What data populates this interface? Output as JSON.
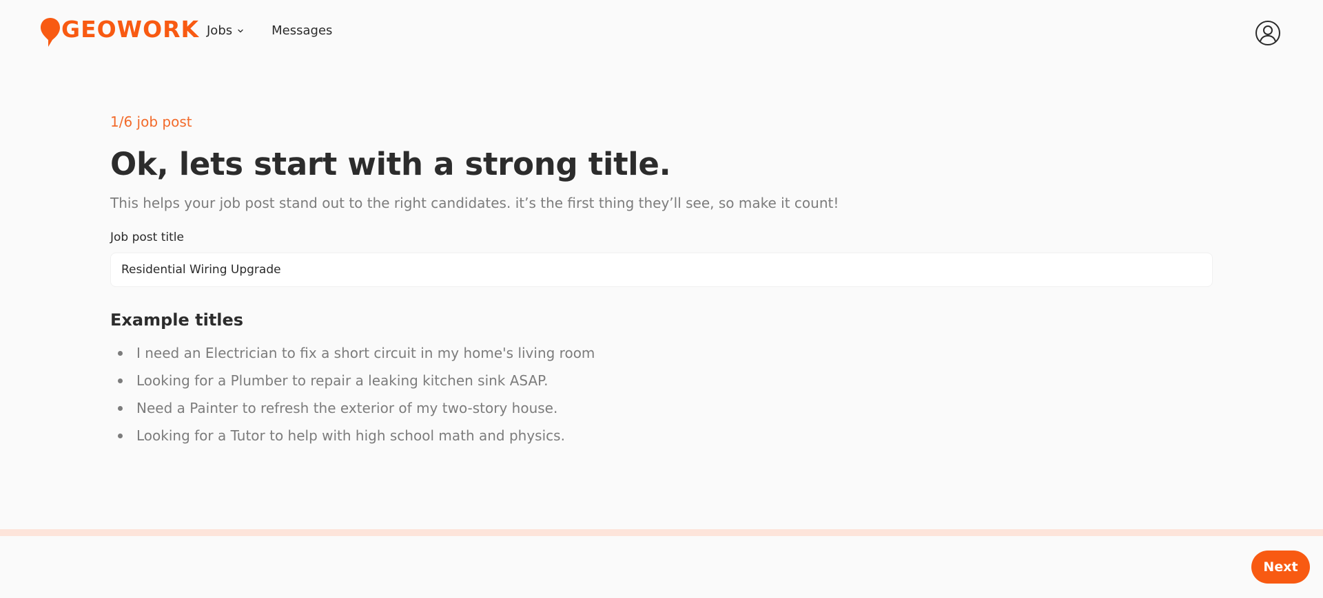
{
  "brand": {
    "name": "GEOWORK",
    "accent_color": "#f85a12"
  },
  "nav": {
    "jobs_label": "Jobs",
    "messages_label": "Messages"
  },
  "header": {
    "profile_icon": "user-circle-icon"
  },
  "main": {
    "step": "1/6 job post",
    "title": "Ok, lets start with a strong title.",
    "subtitle": "This helps your job post stand out to the right candidates. it’s the first thing they’ll see, so make it count!",
    "field_label": "Job post title",
    "field_value": "Residential Wiring Upgrade",
    "examples_title": "Example titles",
    "examples": [
      "I need an Electrician to fix a short circuit in my home's living room",
      "Looking for a Plumber to repair a leaking kitchen sink ASAP.",
      "Need a Painter to refresh the exterior of my two-story house.",
      "Looking for a Tutor to help with high school math and physics."
    ]
  },
  "footer": {
    "next_label": "Next"
  }
}
